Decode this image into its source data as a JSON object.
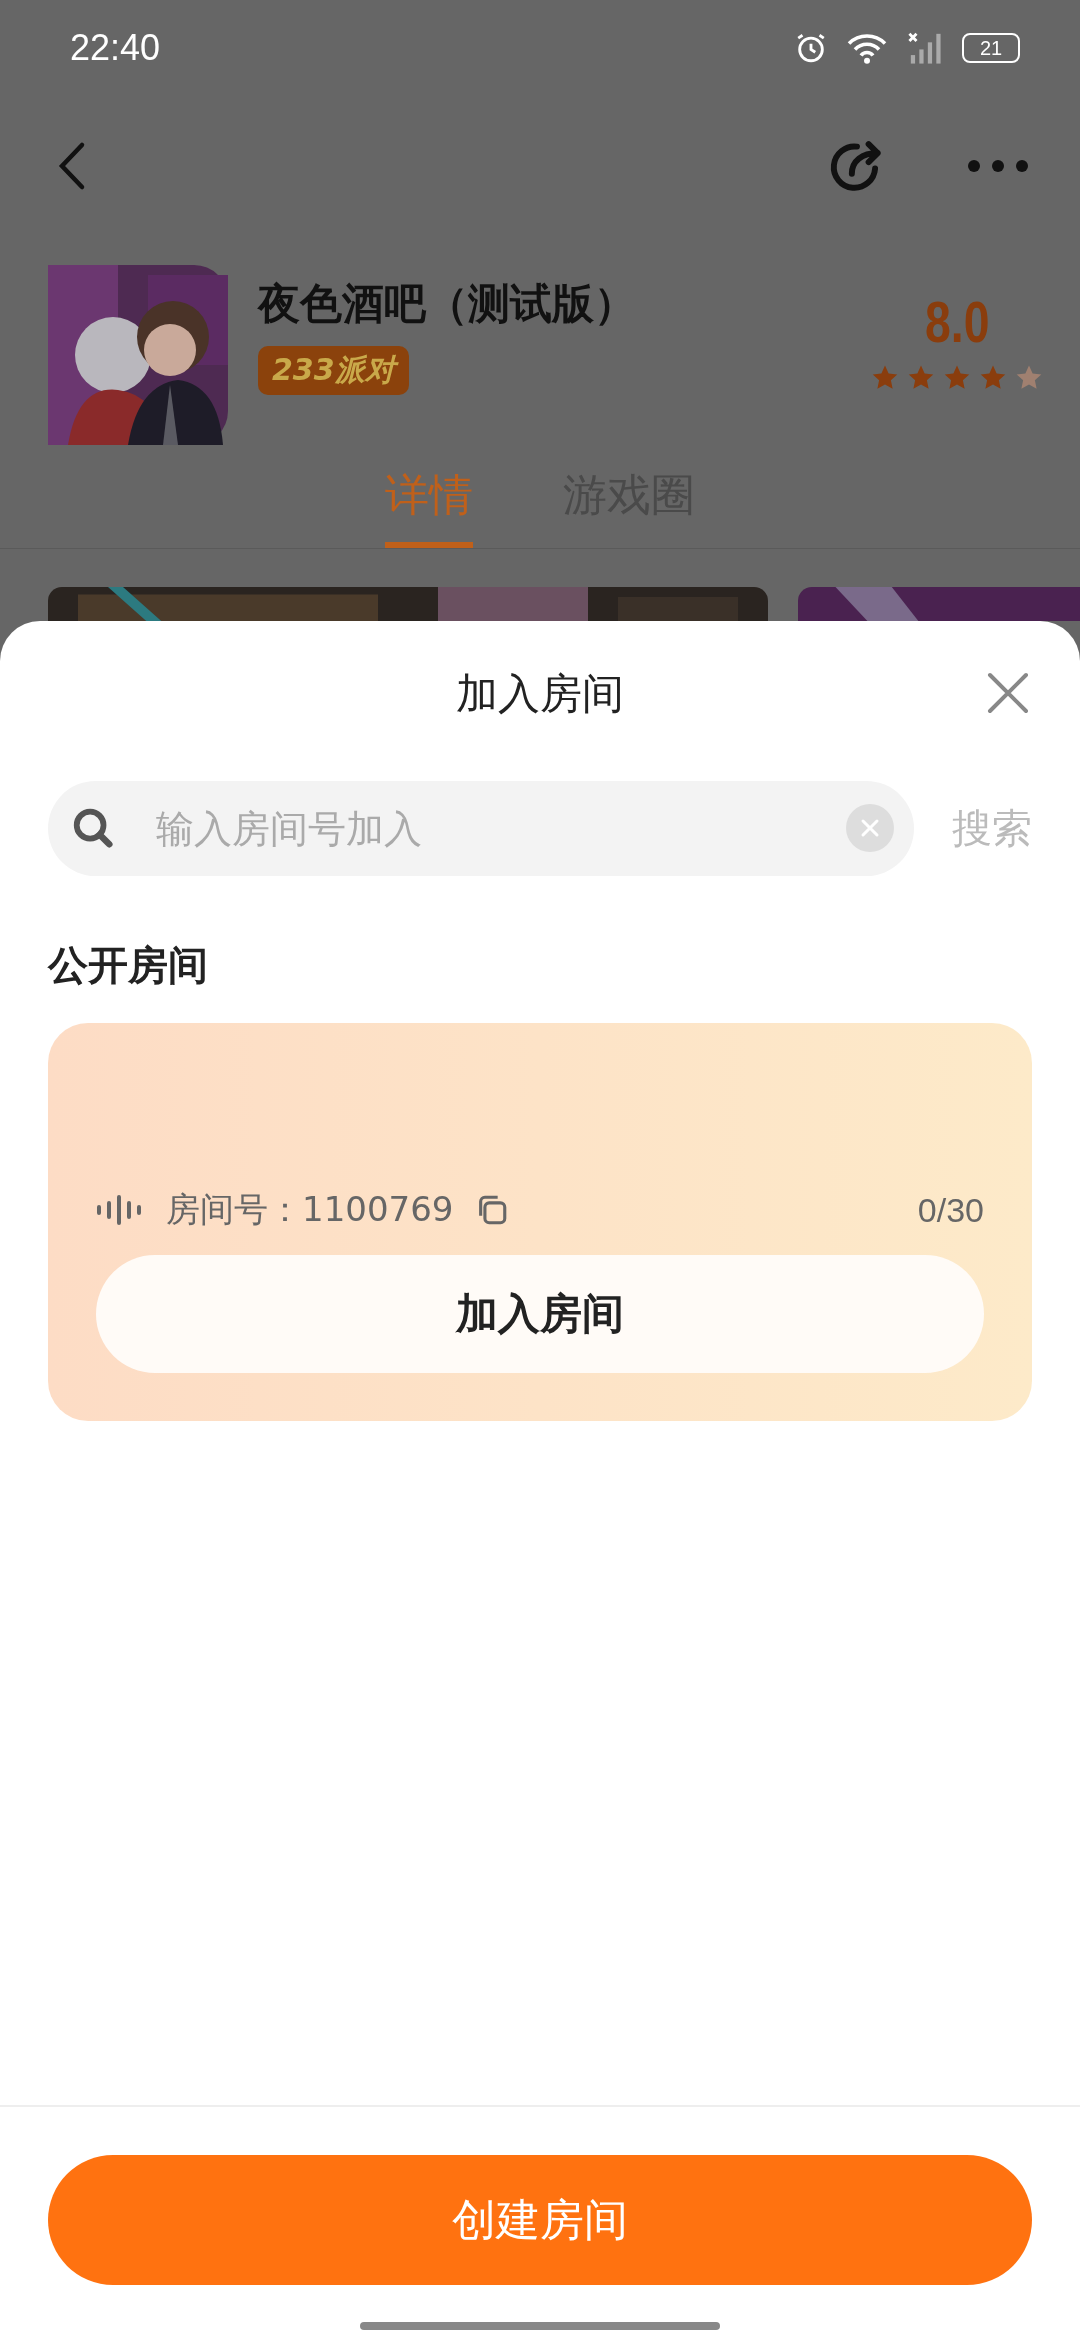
{
  "status_bar": {
    "time": "22:40",
    "battery": "21"
  },
  "header": {
    "title": "夜色酒吧（测试版）",
    "badge": "233派对",
    "rating": "8.0",
    "stars": 4
  },
  "tabs": [
    {
      "label": "详情",
      "selected": true
    },
    {
      "label": "游戏圈",
      "selected": false
    }
  ],
  "sheet": {
    "title": "加入房间",
    "search": {
      "placeholder": "输入房间号加入",
      "button": "搜索"
    },
    "section_title": "公开房间",
    "rooms": [
      {
        "room_id": "房间号：1100769",
        "occupancy": "0/30",
        "button": "加入房间"
      }
    ],
    "create_button": "创建房间"
  }
}
